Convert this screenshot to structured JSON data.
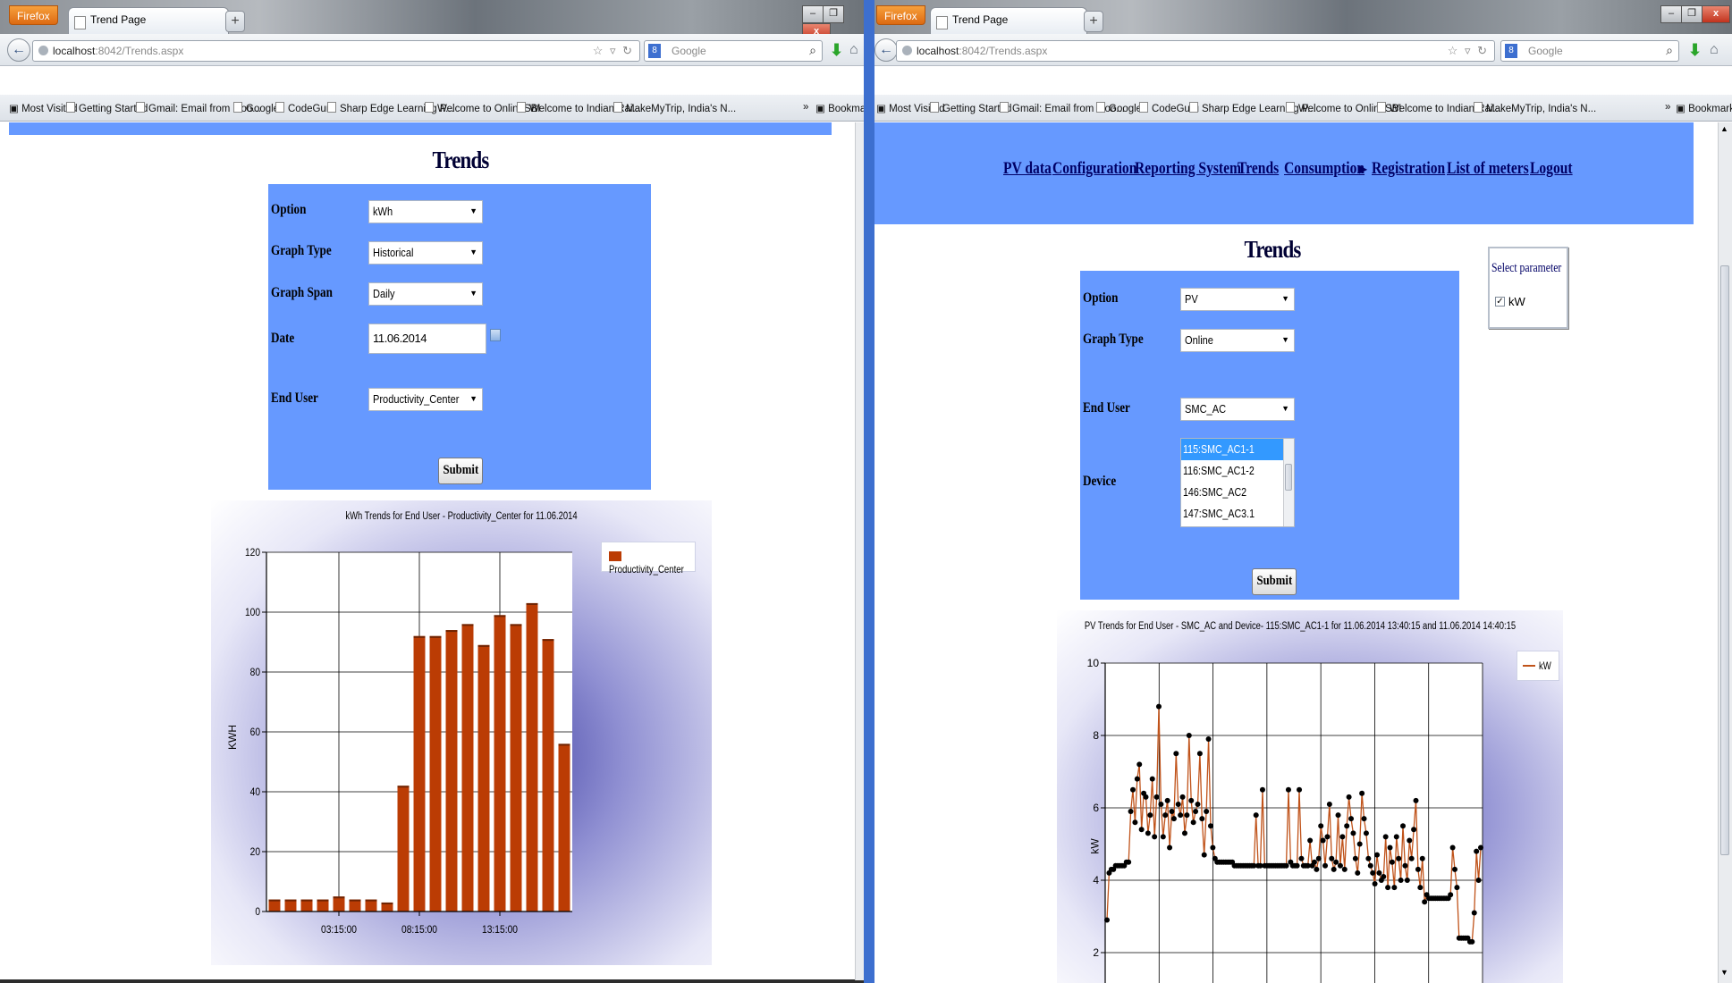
{
  "left": {
    "browser": {
      "menu_button": "Firefox",
      "tab_title": "Trend Page",
      "new_tab": "+",
      "url_host": "localhost",
      "url_rest": ":8042/Trends.aspx",
      "search_placeholder": "Google",
      "bookmarks": [
        "Most Visited",
        "Getting Started",
        "Gmail: Email from Goo...",
        "Google",
        "CodeGuru",
        "Sharp Edge Learning P...",
        "Welcome to OnlineSBI",
        "Welcome to Indian Rai...",
        "MakeMyTrip, India's N..."
      ],
      "bookmarks_overflow": "»",
      "bookmarks_menu": "Bookmark"
    },
    "page": {
      "title": "Trends",
      "form": {
        "option_label": "Option",
        "option_value": "kWh",
        "graph_type_label": "Graph Type",
        "graph_type_value": "Historical",
        "graph_span_label": "Graph Span",
        "graph_span_value": "Daily",
        "date_label": "Date",
        "date_value": "11.06.2014",
        "end_user_label": "End User",
        "end_user_value": "Productivity_Center",
        "submit": "Submit"
      }
    }
  },
  "right": {
    "browser": {
      "menu_button": "Firefox",
      "tab_title": "Trend Page",
      "new_tab": "+",
      "url_host": "localhost",
      "url_rest": ":8042/Trends.aspx",
      "search_placeholder": "Google",
      "bookmarks": [
        "Most Visited",
        "Getting Started",
        "Gmail: Email from Goo...",
        "Google",
        "CodeGuru",
        "Sharp Edge Learning P...",
        "Welcome to OnlineSBI",
        "Welcome to Indian Rai...",
        "MakeMyTrip, India's N..."
      ],
      "bookmarks_overflow": "»",
      "bookmarks_menu": "Bookmarks"
    },
    "nav": [
      "PV data",
      "Configuration",
      "Reporting System",
      "Trends",
      "Consumption",
      "Registration",
      "List of meters",
      "Logout"
    ],
    "page": {
      "title": "Trends",
      "form": {
        "option_label": "Option",
        "option_value": "PV",
        "graph_type_label": "Graph Type",
        "graph_type_value": "Online",
        "end_user_label": "End User",
        "end_user_value": "SMC_AC",
        "device_label": "Device",
        "devices": [
          "115:SMC_AC1-1",
          "116:SMC_AC1-2",
          "146:SMC_AC2",
          "147:SMC_AC3.1"
        ],
        "selected_device_index": 0,
        "submit": "Submit"
      },
      "param_panel": {
        "title": "Select parameter",
        "checkbox_label": "kW",
        "checked": true
      }
    }
  },
  "colors": {
    "page_blue": "#6699ff",
    "bar": "#bb3c04",
    "line": "#c0531a",
    "divider": "#3d6fcf"
  },
  "chart_data": [
    {
      "type": "bar",
      "title": "kWh Trends for End User - Productivity_Center for 11.06.2014",
      "ylabel": "KWH",
      "xlabel": "",
      "ylim": [
        0,
        120
      ],
      "yticks": [
        0,
        20,
        40,
        60,
        80,
        100,
        120
      ],
      "xtick_labels": [
        "03:15:00",
        "08:15:00",
        "13:15:00"
      ],
      "xtick_category_index": [
        4,
        9,
        14
      ],
      "grid": true,
      "legend_position": "top-right",
      "series": [
        {
          "name": "Productivity_Center",
          "values": [
            4,
            4,
            4,
            4,
            5,
            4,
            4,
            3,
            42,
            92,
            92,
            94,
            96,
            89,
            99,
            96,
            103,
            91,
            56
          ]
        }
      ]
    },
    {
      "type": "line",
      "title": "PV Trends for End User - SMC_AC and  Device- 115:SMC_AC1-1 for 11.06.2014 13:40:15 and 11.06.2014 14:40:15",
      "ylabel": "kW",
      "xlabel": "",
      "ylim_visible": [
        1.5,
        10
      ],
      "yticks": [
        2,
        4,
        6,
        8,
        10
      ],
      "grid": true,
      "legend_position": "top-right",
      "series": [
        {
          "name": "kW",
          "values": [
            2.9,
            4.2,
            4.3,
            4.3,
            4.4,
            4.4,
            4.4,
            4.4,
            4.4,
            4.5,
            4.5,
            5.9,
            6.5,
            5.6,
            6.8,
            7.2,
            5.4,
            6.4,
            6.3,
            5.3,
            5.8,
            6.8,
            5.2,
            6.3,
            8.8,
            6.1,
            5.2,
            5.8,
            6.2,
            4.9,
            5.9,
            5.7,
            7.5,
            6.1,
            5.8,
            6.3,
            5.3,
            5.8,
            8.0,
            6.2,
            5.6,
            5.9,
            6.1,
            7.5,
            5.7,
            4.7,
            5.9,
            7.9,
            5.5,
            4.9,
            4.6,
            4.5,
            4.5,
            4.5,
            4.5,
            4.5,
            4.5,
            4.5,
            4.5,
            4.4,
            4.4,
            4.4,
            4.4,
            4.4,
            4.4,
            4.4,
            4.4,
            4.4,
            4.4,
            5.8,
            4.4,
            4.4,
            6.5,
            4.4,
            4.4,
            4.4,
            4.4,
            4.4,
            4.4,
            4.4,
            4.4,
            4.4,
            4.4,
            4.4,
            6.5,
            4.5,
            4.4,
            4.4,
            4.4,
            6.5,
            4.6,
            4.4,
            4.4,
            4.4,
            5.1,
            4.4,
            4.5,
            4.3,
            4.6,
            5.5,
            5.1,
            4.4,
            5.2,
            6.1,
            4.6,
            4.3,
            4.5,
            5.8,
            4.4,
            5.2,
            4.3,
            5.5,
            6.3,
            5.7,
            5.3,
            4.6,
            4.2,
            5.0,
            6.4,
            5.7,
            5.3,
            4.6,
            4.4,
            4.2,
            3.9,
            4.7,
            4.2,
            4.0,
            4.1,
            5.2,
            3.8,
            4.9,
            4.5,
            3.8,
            5.2,
            4.6,
            4.0,
            5.5,
            4.4,
            4.0,
            5.1,
            4.6,
            5.4,
            6.2,
            4.3,
            3.8,
            4.6,
            3.4,
            3.6,
            3.5,
            3.5,
            3.5,
            3.5,
            3.5,
            3.5,
            3.5,
            3.5,
            3.5,
            3.5,
            3.6,
            4.9,
            4.3,
            3.8,
            2.4,
            2.4,
            2.4,
            2.4,
            2.4,
            2.3,
            2.3,
            3.1,
            4.8,
            4.0,
            4.9
          ]
        }
      ]
    }
  ]
}
